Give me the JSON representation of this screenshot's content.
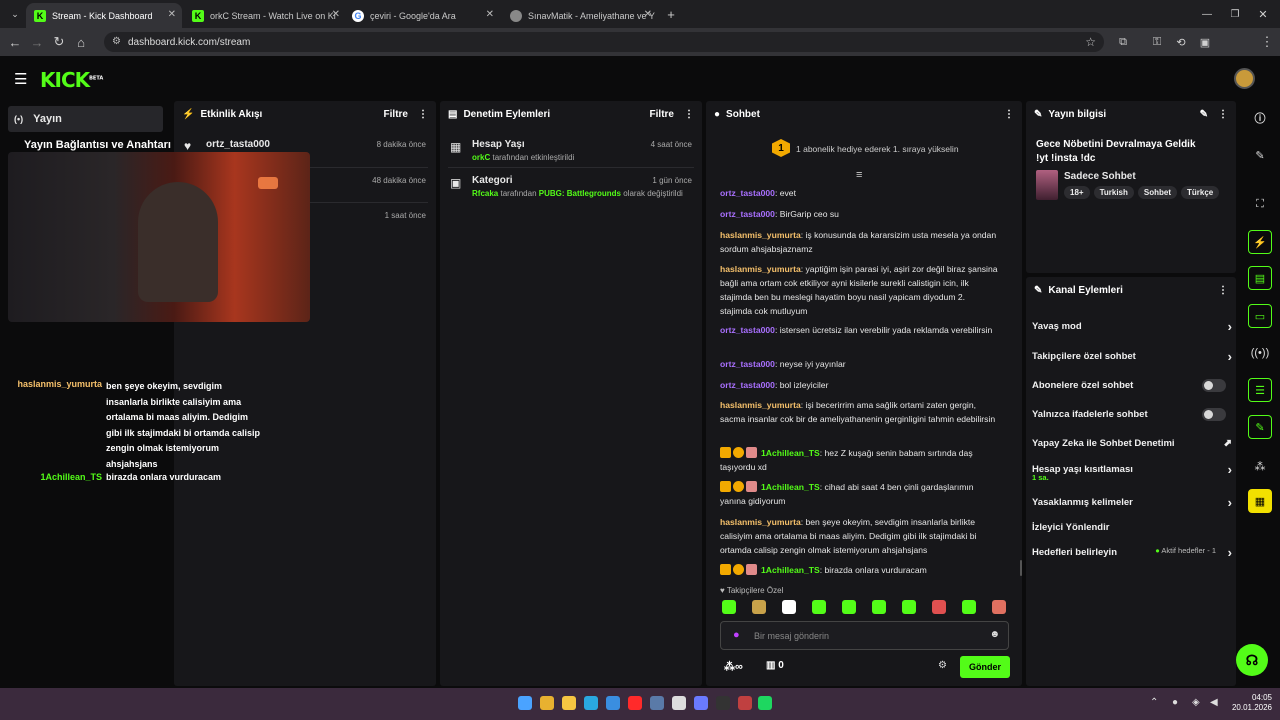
{
  "browser": {
    "tabs": [
      {
        "title": "Stream - Kick Dashboard"
      },
      {
        "title": "orkC Stream - Watch Live on Ki"
      },
      {
        "title": "çeviri - Google'da Ara"
      },
      {
        "title": "SınavMatik - Ameliyathane ve Y"
      }
    ],
    "url": "dashboard.kick.com/stream"
  },
  "kick": {
    "logo": "KICK",
    "logo_badge": "BETA",
    "nav_item": "Yayın",
    "left_title": "Yayın Bağlantısı ve Anahtarı"
  },
  "overlay_chat": [
    {
      "user": "haslanmis_yumurta",
      "text": "ben şeye okeyim, sevdigim insanlarla birlikte calisiyim ama ortalama bi maas aliyim. Dedigim gibi ilk stajimdaki bi ortamda calisip zengin olmak istemiyorum ahsjahsjans"
    },
    {
      "user": "1Achillean_TS",
      "text": "birazda onlara vurduracam"
    }
  ],
  "activity": {
    "title": "Etkinlik Akışı",
    "filter": "Filtre",
    "items": [
      {
        "user": "ortz_tasta000",
        "time": "8 dakika önce"
      },
      {
        "user": "",
        "time": "48 dakika önce"
      },
      {
        "user": "",
        "time": "1 saat önce"
      }
    ]
  },
  "moderation": {
    "title": "Denetim Eylemleri",
    "filter": "Filtre",
    "items": [
      {
        "title": "Hesap Yaşı",
        "time": "4 saat önce",
        "actor": "orkC",
        "desc": "tarafından etkinleştirildi",
        "target": ""
      },
      {
        "title": "Kategori",
        "time": "1 gün önce",
        "actor": "Rfcaka",
        "desc": "tarafından",
        "target": "PUBG: Battlegrounds",
        "desc2": "olarak değiştirildi"
      }
    ]
  },
  "chat": {
    "title": "Sohbet",
    "promo": "1 abonelik hediye ederek 1. sıraya yükselin",
    "promo_rank": "1",
    "messages": [
      {
        "user": "ortz_tasta000",
        "color": "#a970ff",
        "text": "evet"
      },
      {
        "user": "ortz_tasta000",
        "color": "#a970ff",
        "text": "BirGarip ceo su"
      },
      {
        "user": "haslanmis_yumurta",
        "color": "#f5c06b",
        "text": "iş konusunda da kararsizim usta mesela ya ondan sordum ahsjabsjaznamz"
      },
      {
        "user": "haslanmis_yumurta",
        "color": "#f5c06b",
        "text": "yaptiğim işin parasi iyi, aşiri zor değil biraz şansina bağli ama ortam cok etkiliyor ayni kisilerle surekli calistigin icin, ilk stajimda ben bu meslegi hayatim boyu nasil yapicam diyodum 2. stajimda cok mutluyum"
      },
      {
        "user": "ortz_tasta000",
        "color": "#a970ff",
        "text": "istersen ücretsiz ilan verebilir yada reklamda verebilirsin"
      },
      {
        "user": "ortz_tasta000",
        "color": "#a970ff",
        "text": "neyse iyi yayınlar"
      },
      {
        "user": "ortz_tasta000",
        "color": "#a970ff",
        "text": "bol izleyiciler"
      },
      {
        "user": "haslanmis_yumurta",
        "color": "#f5c06b",
        "text": "işi becerirrim ama sağlik ortami zaten gergin, sacma insanlar cok bir de ameliyathanenin gerginligini tahmin edebilirsin"
      },
      {
        "user": "1Achillean_TS",
        "color": "#53fc18",
        "text": "hez Z kuşağı senin babam sırtında daş taşıyordu xd",
        "badges": true
      },
      {
        "user": "1Achillean_TS",
        "color": "#53fc18",
        "text": "cihad abi saat 4 ben çinli gardaşlarımın yanına gidiyorum",
        "badges": true
      },
      {
        "user": "haslanmis_yumurta",
        "color": "#f5c06b",
        "text": "ben şeye okeyim, sevdigim insanlarla birlikte calisiyim ama ortalama bi maas aliyim. Dedigim gibi ilk stajimdaki bi ortamda calisip zengin olmak istemiyorum ahsjahsjans"
      },
      {
        "user": "1Achillean_TS",
        "color": "#53fc18",
        "text": "birazda onlara vurduracam",
        "badges": true
      }
    ],
    "followers_only_label": "Takipçilere Özel",
    "input_placeholder": "Bir mesaj gönderin",
    "viewers": "∞",
    "points": "0",
    "send": "Gönder"
  },
  "stream_info": {
    "title": "Yayın bilgisi",
    "stream_title": "Gece Nöbetini Devralmaya Geldik !yt !insta !dc",
    "category": "Sadece Sohbet",
    "tags": [
      "18+",
      "Turkish",
      "Sohbet",
      "Türkçe"
    ]
  },
  "channel_actions": {
    "title": "Kanal Eylemleri",
    "items": [
      {
        "label": "Yavaş mod",
        "control": "chevron"
      },
      {
        "label": "Takipçilere özel sohbet",
        "control": "chevron"
      },
      {
        "label": "Abonelere özel sohbet",
        "control": "toggle"
      },
      {
        "label": "Yalnızca ifadelerle sohbet",
        "control": "toggle"
      },
      {
        "label": "Yapay Zeka ile Sohbet Denetimi",
        "control": "chart"
      },
      {
        "label": "Hesap yaşı kısıtlaması",
        "sub": "1 sa.",
        "control": "chevron"
      },
      {
        "label": "Yasaklanmış kelimeler",
        "control": "chevron"
      },
      {
        "label": "İzleyici Yönlendir",
        "control": "none"
      },
      {
        "label": "Hedefleri belirleyin",
        "status": "Aktif hedefler - 1",
        "control": "chevron"
      }
    ]
  },
  "taskbar": {
    "time": "04:05",
    "date": "20.01.2026"
  }
}
